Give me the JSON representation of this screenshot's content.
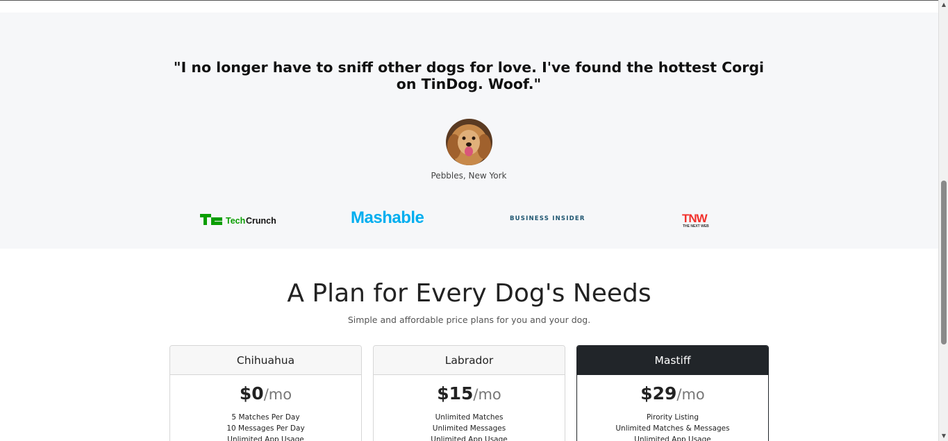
{
  "testimonial": {
    "quote": "\"I no longer have to sniff other dogs for love. I've found the hottest Corgi on TinDog. Woof.\"",
    "author": "Pebbles, New York"
  },
  "press": {
    "techcrunch": "TechCrunch",
    "mashable": "Mashable",
    "business_insider": "BUSINESS INSIDER",
    "tnw": "TNW",
    "tnw_sub": "THE NEXT WEB"
  },
  "pricing": {
    "title": "A Plan for Every Dog's Needs",
    "subtitle": "Simple and affordable price plans for you and your dog.",
    "plans": [
      {
        "name": "Chihuahua",
        "price": "$0",
        "per": "/mo",
        "features": [
          "5 Matches Per Day",
          "10 Messages Per Day",
          "Unlimited App Usage"
        ]
      },
      {
        "name": "Labrador",
        "price": "$15",
        "per": "/mo",
        "features": [
          "Unlimited Matches",
          "Unlimited Messages",
          "Unlimited App Usage"
        ]
      },
      {
        "name": "Mastiff",
        "price": "$29",
        "per": "/mo",
        "features": [
          "Pirority Listing",
          "Unlimited Matches & Messages",
          "Unlimited App Usage"
        ]
      }
    ]
  },
  "colors": {
    "section_bg": "#f6f7f9",
    "mashable": "#00aeef",
    "techcrunch": "#0a9e01",
    "tnw": "#f2302b",
    "dark_card": "#212529"
  }
}
